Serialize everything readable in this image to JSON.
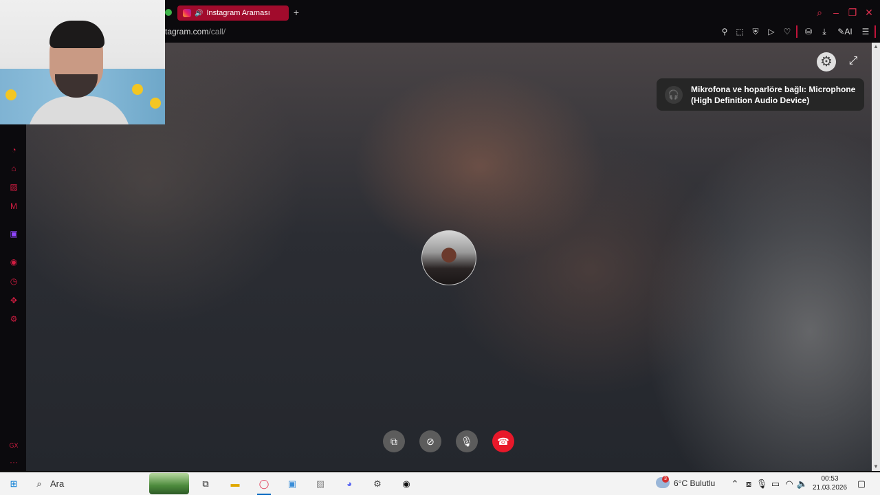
{
  "browser": {
    "tab_title": "Instagram Araması",
    "tab_audio_icon": "speaker-icon",
    "new_tab_label": "+",
    "url_host": "tagram.com",
    "url_path": "/call/",
    "accent_color": "#c2143a"
  },
  "call": {
    "toast_line1": "Mikrofona ve hoparlöre bağlı: Microphone",
    "toast_line2": "(High Definition Audio Device)",
    "controls": [
      {
        "name": "screen-share",
        "icon": "screen-share-icon"
      },
      {
        "name": "camera",
        "icon": "camera-off-icon"
      },
      {
        "name": "microphone",
        "icon": "microphone-icon"
      },
      {
        "name": "end-call",
        "icon": "hang-up-icon",
        "color": "#e8182a"
      }
    ]
  },
  "taskbar": {
    "search_placeholder": "Ara",
    "weather_text": "6°C  Bulutlu",
    "weather_badge": "3",
    "time": "00:53",
    "date": "21.03.2026"
  }
}
